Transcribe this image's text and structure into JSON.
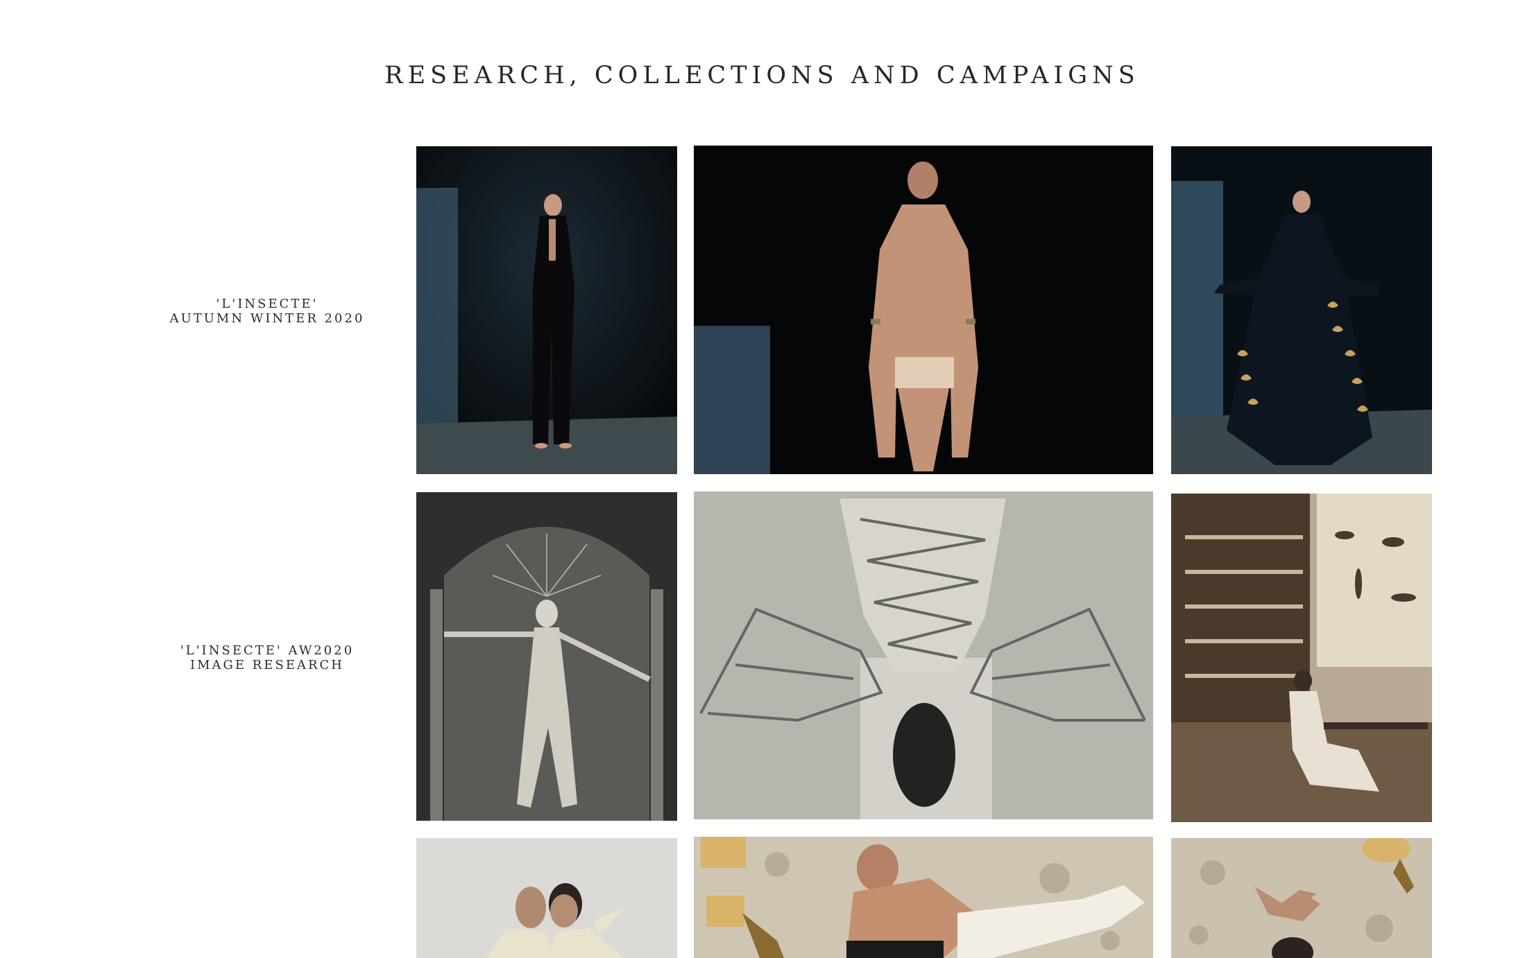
{
  "page": {
    "title": "RESEARCH, COLLECTIONS AND CAMPAIGNS"
  },
  "rows": [
    {
      "caption_line1": "'L'INSECTE'",
      "caption_line2": "AUTUMN WINTER 2020",
      "tiles": [
        {
          "subject": "model in black velvet suit on dark stage"
        },
        {
          "subject": "shirtless model in nude briefs with arm cuffs"
        },
        {
          "subject": "model in black robe with gold moon print"
        }
      ]
    },
    {
      "caption_line1": "'L'INSECTE' AW2020",
      "caption_line2": "IMAGE RESEARCH",
      "tiles": [
        {
          "subject": "vintage photo of dancer in fringed costume with sunburst headdress"
        },
        {
          "subject": "vintage photo of laced corset with wire cage panniers and mask"
        },
        {
          "subject": "sepia photo of man in apothecary laboratory with insect charts"
        }
      ]
    },
    {
      "caption_line1": "",
      "caption_line2": "",
      "tiles": [
        {
          "subject": "two models in cream outfits face to face"
        },
        {
          "subject": "shirtless model lying on patterned rug with lamp"
        },
        {
          "subject": "model with crossed arms lying on patterned rug"
        }
      ]
    }
  ]
}
